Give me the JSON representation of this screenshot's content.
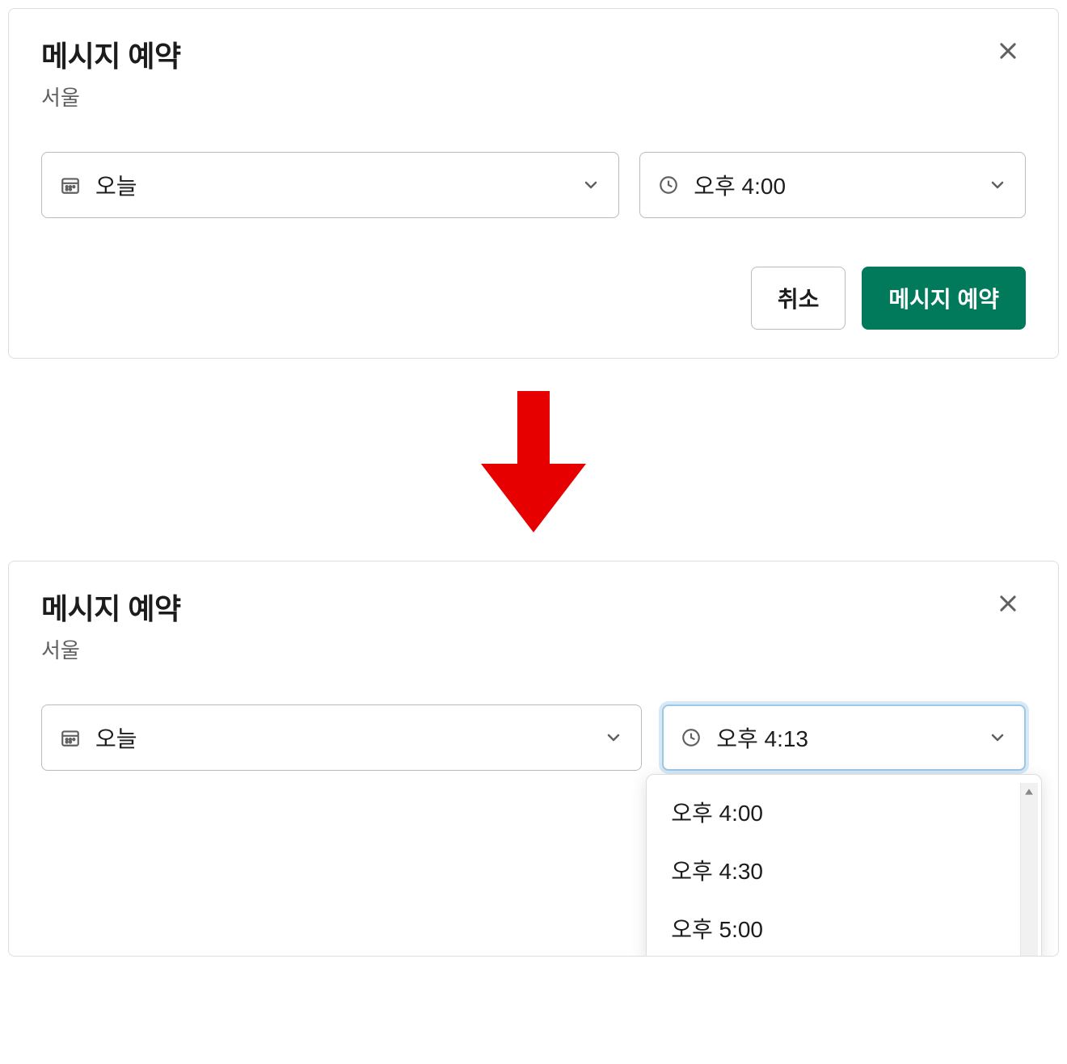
{
  "dialog1": {
    "title": "메시지 예약",
    "subtitle": "서울",
    "dateValue": "오늘",
    "timeValue": "오후 4:00",
    "cancelLabel": "취소",
    "submitLabel": "메시지 예약"
  },
  "dialog2": {
    "title": "메시지 예약",
    "subtitle": "서울",
    "dateValue": "오늘",
    "timeValue": "오후 4:13",
    "dropdown": {
      "options": [
        "오후 4:00",
        "오후 4:30",
        "오후 5:00"
      ]
    }
  },
  "colors": {
    "primary": "#007a5a",
    "arrow": "#e60000"
  }
}
